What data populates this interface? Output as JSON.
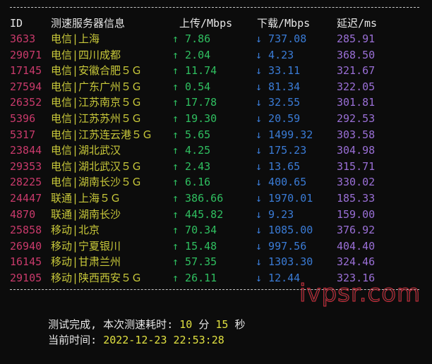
{
  "header": {
    "id": "ID",
    "node": "测速服务器信息",
    "upload": "上传/Mbps",
    "download": "下载/Mbps",
    "latency": "延迟/ms"
  },
  "rows": [
    {
      "id": "3633",
      "node": "电信|上海",
      "up": "↑ 7.86",
      "down": "↓ 737.08",
      "lat": "285.91"
    },
    {
      "id": "29071",
      "node": "电信|四川成都",
      "up": "↑ 2.04",
      "down": "↓ 4.23",
      "lat": "368.50"
    },
    {
      "id": "17145",
      "node": "电信|安徽合肥５Ｇ",
      "up": "↑ 11.74",
      "down": "↓ 33.11",
      "lat": "321.67"
    },
    {
      "id": "27594",
      "node": "电信|广东广州５Ｇ",
      "up": "↑ 0.54",
      "down": "↓ 81.34",
      "lat": "322.05"
    },
    {
      "id": "26352",
      "node": "电信|江苏南京５Ｇ",
      "up": "↑ 17.78",
      "down": "↓ 32.55",
      "lat": "301.81"
    },
    {
      "id": "5396",
      "node": "电信|江苏苏州５Ｇ",
      "up": "↑ 19.30",
      "down": "↓ 20.59",
      "lat": "292.53"
    },
    {
      "id": "5317",
      "node": "电信|江苏连云港５Ｇ",
      "up": "↑ 5.65",
      "down": "↓ 1499.32",
      "lat": "303.58"
    },
    {
      "id": "23844",
      "node": "电信|湖北武汉",
      "up": "↑ 4.25",
      "down": "↓ 175.23",
      "lat": "304.98"
    },
    {
      "id": "29353",
      "node": "电信|湖北武汉５Ｇ",
      "up": "↑ 2.43",
      "down": "↓ 13.65",
      "lat": "315.71"
    },
    {
      "id": "28225",
      "node": "电信|湖南长沙５Ｇ",
      "up": "↑ 6.16",
      "down": "↓ 400.65",
      "lat": "330.02"
    },
    {
      "id": "24447",
      "node": "联通|上海５Ｇ",
      "up": "↑ 386.66",
      "down": "↓ 1970.01",
      "lat": "185.33"
    },
    {
      "id": "4870",
      "node": "联通|湖南长沙",
      "up": "↑ 445.82",
      "down": "↓ 9.23",
      "lat": "159.00"
    },
    {
      "id": "25858",
      "node": "移动|北京",
      "up": "↑ 70.34",
      "down": "↓ 1085.00",
      "lat": "376.92"
    },
    {
      "id": "26940",
      "node": "移动|宁夏银川",
      "up": "↑ 15.48",
      "down": "↓ 997.56",
      "lat": "404.40"
    },
    {
      "id": "16145",
      "node": "移动|甘肃兰州",
      "up": "↑ 57.35",
      "down": "↓ 1303.30",
      "lat": "324.46"
    },
    {
      "id": "29105",
      "node": "移动|陕西西安５Ｇ",
      "up": "↑ 26.11",
      "down": "↓ 12.44",
      "lat": "323.16"
    }
  ],
  "summary": {
    "done_prefix": "测试完成, 本次测速耗时: ",
    "minutes": "10",
    "min_unit": " 分 ",
    "seconds": "15",
    "sec_unit": " 秒",
    "time_label": "当前时间: ",
    "time_value": "2022-12-23 22:53:28"
  },
  "watermark": "ivpsr.com",
  "colors": {
    "background": "#0c0c0c",
    "id": "#c93a6b",
    "node": "#c9c93a",
    "upload": "#2fbf60",
    "download": "#3a7bd5",
    "latency": "#9a6fd6",
    "watermark_stroke": "#d9303f"
  }
}
